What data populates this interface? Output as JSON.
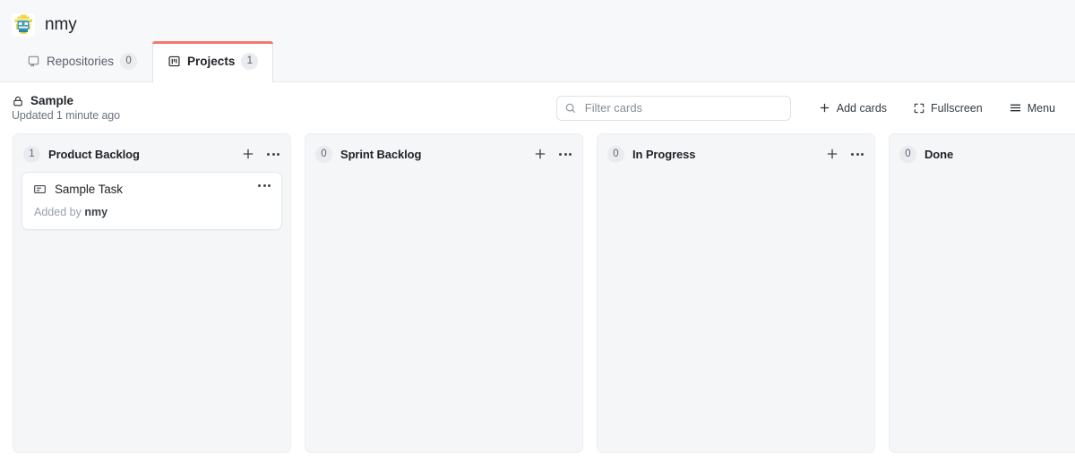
{
  "topnav": {
    "user": "nmy",
    "avatar_icon": "identicon-avatar",
    "tabs": [
      {
        "label": "Repositories",
        "count": "0",
        "icon": "repo-icon",
        "active": false
      },
      {
        "label": "Projects",
        "count": "1",
        "icon": "project-board-icon",
        "active": true
      }
    ]
  },
  "project": {
    "lock_icon": "lock-icon",
    "title": "Sample",
    "updated": "Updated 1 minute ago"
  },
  "toolbar": {
    "search_placeholder": "Filter cards",
    "search_value": "",
    "search_icon": "search-icon",
    "add_cards_label": "Add cards",
    "add_cards_icon": "plus-icon",
    "fullscreen_label": "Fullscreen",
    "fullscreen_icon": "fullscreen-icon",
    "menu_label": "Menu",
    "menu_icon": "hamburger-menu-icon"
  },
  "board": {
    "columns": [
      {
        "title": "Product Backlog",
        "count": "1",
        "add_icon": "plus-icon",
        "menu_icon": "kebab-menu-icon",
        "cards": [
          {
            "icon": "note-card-icon",
            "title": "Sample Task",
            "meta_prefix": "Added by",
            "meta_author": "nmy",
            "menu_icon": "kebab-menu-icon"
          }
        ]
      },
      {
        "title": "Sprint Backlog",
        "count": "0",
        "add_icon": "plus-icon",
        "menu_icon": "kebab-menu-icon",
        "cards": []
      },
      {
        "title": "In Progress",
        "count": "0",
        "add_icon": "plus-icon",
        "menu_icon": "kebab-menu-icon",
        "cards": []
      },
      {
        "title": "Done",
        "count": "0",
        "add_icon": "plus-icon",
        "menu_icon": "kebab-menu-icon",
        "cards": []
      }
    ]
  },
  "colors": {
    "accent": "#f4796b",
    "column_bg": "#f5f6f8",
    "topnav_bg": "#f7f8fa"
  }
}
